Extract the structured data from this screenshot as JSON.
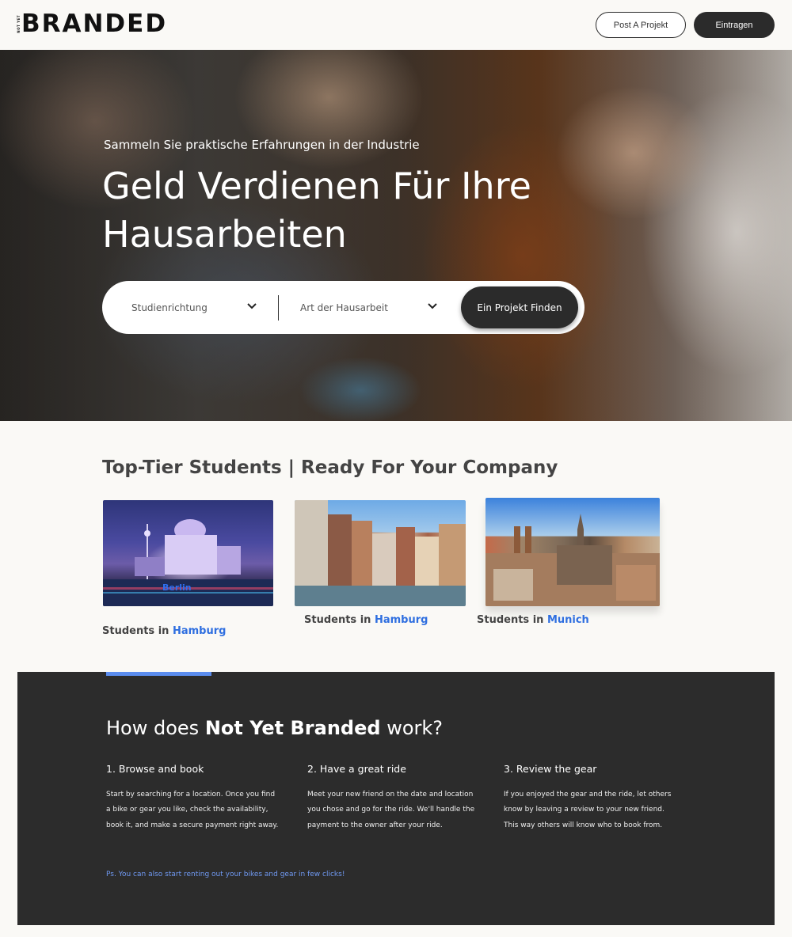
{
  "header": {
    "logo_small": "NOT YET",
    "logo_text": "BRANDED",
    "post_button": "Post A Projekt",
    "signup_button": "Eintragen"
  },
  "hero": {
    "eyebrow": "Sammeln Sie praktische Erfahrungen in der Industrie",
    "title": "Geld Verdienen Für Ihre Hausarbeiten",
    "search": {
      "field_of_study": "Studienrichtung",
      "paper_type": "Art der Hausarbeit",
      "find_button": "Ein Projekt Finden"
    }
  },
  "students": {
    "title": "Top-Tier Students | Ready For Your Company",
    "cards": [
      {
        "prefix": "Students in",
        "city": "Hamburg",
        "image_label": "Berlin"
      },
      {
        "prefix": "Students in",
        "city": "Hamburg"
      },
      {
        "prefix": "Students in",
        "city": "Munich"
      }
    ]
  },
  "how": {
    "title_prefix": "How does",
    "title_brand": "Not Yet Branded",
    "title_suffix": "work?",
    "steps": [
      {
        "title": "1. Browse and book",
        "body": "Start by searching for a location. Once you find a bike or gear you like, check the availability, book it, and make a secure payment right away."
      },
      {
        "title": "2. Have a great ride",
        "body": "Meet your new friend on the date and location you chose and go for the ride. We'll handle the payment to the owner after your ride."
      },
      {
        "title": "3. Review the gear",
        "body": "If you enjoyed the gear and the ride, let others know by leaving a review to your new friend. This way others will know who to book from."
      }
    ],
    "ps": "Ps. You can also start renting out your bikes and gear in few clicks!"
  },
  "colors": {
    "accent_blue": "#2f6fe0",
    "dark": "#2b2b2b",
    "background": "#faf9f6"
  }
}
